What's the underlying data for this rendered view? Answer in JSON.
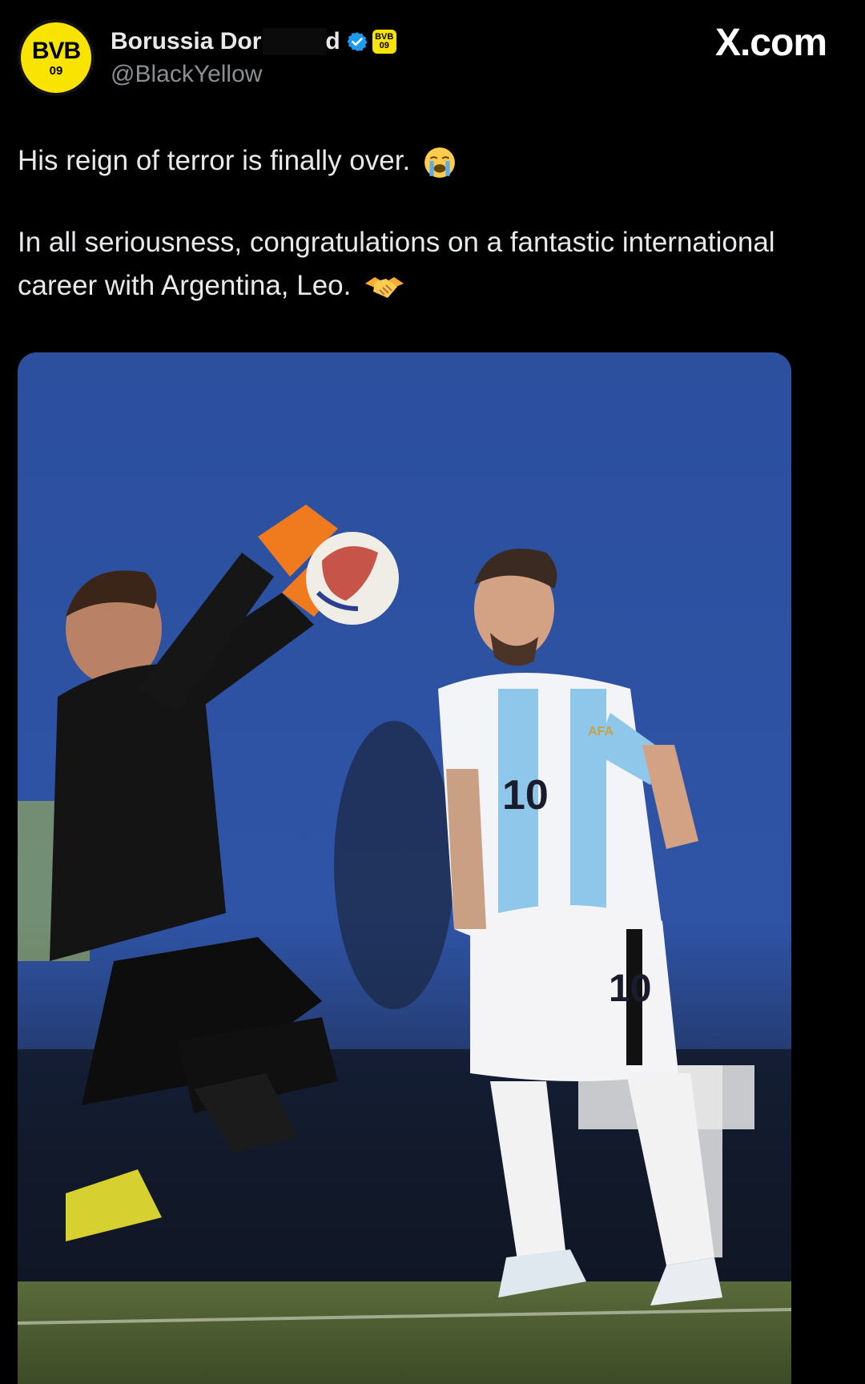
{
  "account": {
    "avatar_top": "BVB",
    "avatar_bottom": "09",
    "display_name": "Borussia Dor",
    "display_name_tail": "d",
    "handle": "@BlackYellow",
    "mini_badge_top": "BVB",
    "mini_badge_bottom": "09"
  },
  "site": {
    "brand": "X.com"
  },
  "post": {
    "line1": "His reign of terror is finally over.",
    "line2": "In all seriousness, congratulations on a fantastic international career with Argentina, Leo.",
    "emoji1": "loudly-crying-face-emoji",
    "emoji2": "handshake-emoji"
  },
  "photo": {
    "jersey_number": "10",
    "crest_text": "AFA"
  },
  "colors": {
    "background": "#000000",
    "text": "#e7e9ea",
    "handle": "#8b8f94",
    "verified": "#1d9bf0",
    "bvb_yellow": "#f9e300",
    "stadium_blue": "#2b4e9c"
  }
}
